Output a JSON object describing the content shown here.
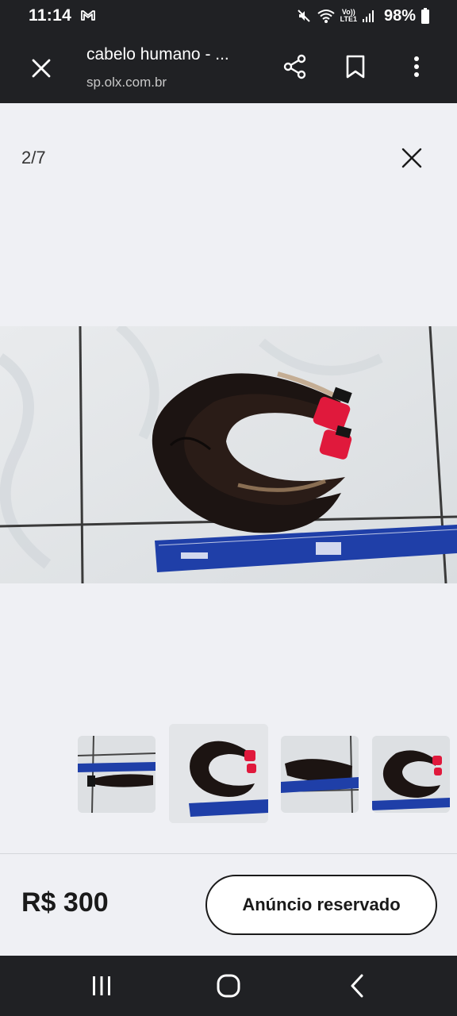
{
  "status_bar": {
    "time": "11:14",
    "battery": "98%",
    "icons": [
      "gmail-icon",
      "mute-icon",
      "wifi-icon",
      "volte-icon",
      "signal-icon",
      "battery-icon"
    ],
    "volte_label_top": "Vo))",
    "volte_label_bottom": "LTE1"
  },
  "toolbar": {
    "title": "cabelo humano - ...",
    "url": "sp.olx.com.br",
    "icons": [
      "close-icon",
      "share-icon",
      "bookmark-icon",
      "more-vert-icon"
    ]
  },
  "gallery": {
    "counter": "2/7",
    "close_icon": "close-icon",
    "thumbnails_count": 4,
    "selected_thumbnail": 2
  },
  "listing": {
    "price": "R$ 300",
    "status_button": "Anúncio reservado"
  },
  "nav_bar": {
    "icons": [
      "recents-icon",
      "home-icon",
      "back-icon"
    ]
  },
  "colors": {
    "dark_bar": "#202124",
    "background": "#eff0f4",
    "ruler_blue": "#1f3fa8",
    "tag_red": "#e0193c"
  }
}
